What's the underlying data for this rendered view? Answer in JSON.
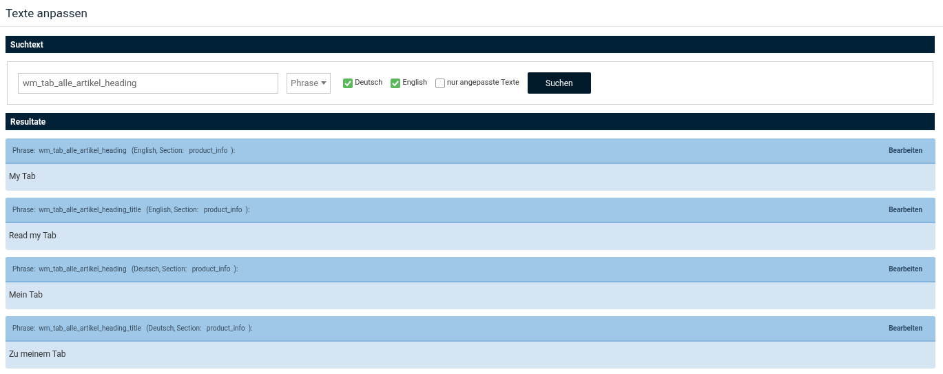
{
  "page_title": "Texte anpassen",
  "search_section": {
    "title": "Suchtext",
    "query": "wm_tab_alle_artikel_heading",
    "scope": "Phrase",
    "options": [
      {
        "label": "Deutsch",
        "checked": true
      },
      {
        "label": "English",
        "checked": true
      },
      {
        "label": "nur angepasste Texte",
        "checked": false
      }
    ],
    "button": "Suchen"
  },
  "results_section": {
    "title": "Resultate",
    "results": [
      {
        "header": "Phrase:  wm_tab_alle_artikel_heading   (English, Section:   product_info  ):",
        "action": "Bearbeiten",
        "text": "My Tab"
      },
      {
        "header": "Phrase:  wm_tab_alle_artikel_heading_title   (English, Section:   product_info  ):",
        "action": "Bearbeiten",
        "text": "Read my Tab"
      },
      {
        "header": "Phrase:  wm_tab_alle_artikel_heading   (Deutsch, Section:   product_info  ):",
        "action": "Bearbeiten",
        "text": "Mein Tab"
      },
      {
        "header": "Phrase:  wm_tab_alle_artikel_heading_title   (Deutsch, Section:   product_info  ):",
        "action": "Bearbeiten",
        "text": "Zu meinem Tab"
      }
    ]
  }
}
